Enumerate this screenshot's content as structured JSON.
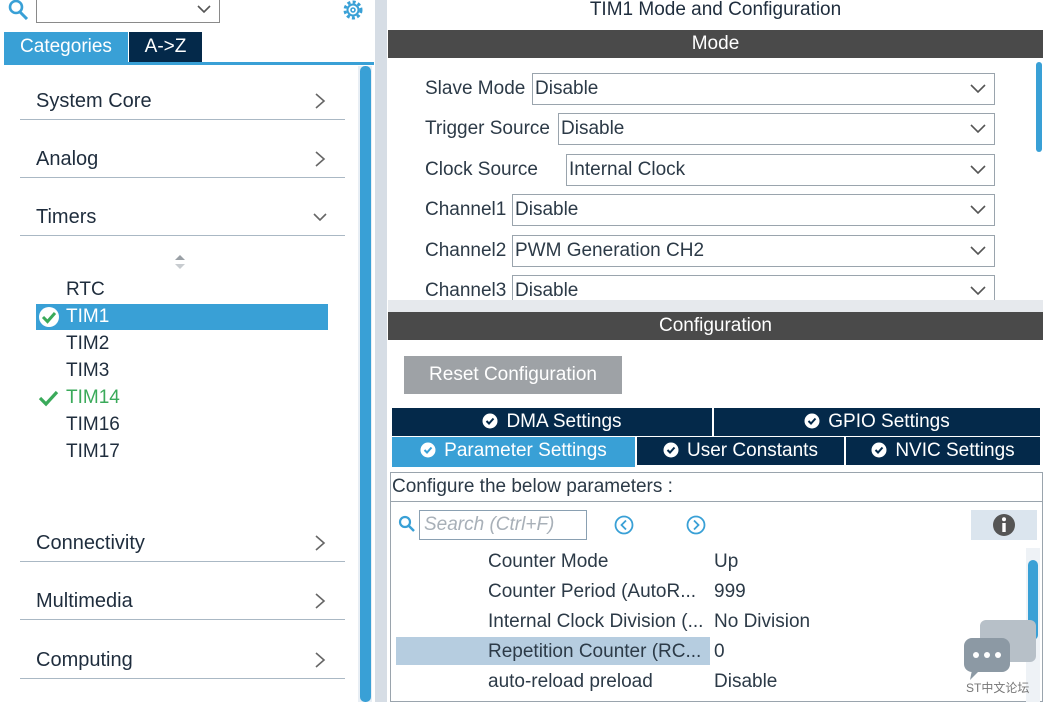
{
  "left_panel": {
    "search_value": "",
    "tabs": {
      "categories": "Categories",
      "az": "A->Z"
    },
    "categories": [
      {
        "label": "System Core",
        "expanded": false
      },
      {
        "label": "Analog",
        "expanded": false
      },
      {
        "label": "Timers",
        "expanded": true
      },
      {
        "label": "Connectivity",
        "expanded": false
      },
      {
        "label": "Multimedia",
        "expanded": false
      },
      {
        "label": "Computing",
        "expanded": false
      }
    ],
    "timers": [
      {
        "label": "RTC",
        "state": "none"
      },
      {
        "label": "TIM1",
        "state": "selected"
      },
      {
        "label": "TIM2",
        "state": "none"
      },
      {
        "label": "TIM3",
        "state": "none"
      },
      {
        "label": "TIM14",
        "state": "configured"
      },
      {
        "label": "TIM16",
        "state": "none"
      },
      {
        "label": "TIM17",
        "state": "none"
      }
    ]
  },
  "right_panel": {
    "title": "TIM1 Mode and Configuration",
    "mode_bar": "Mode",
    "mode_rows": [
      {
        "label": "Slave Mode",
        "value": "Disable"
      },
      {
        "label": "Trigger Source",
        "value": "Disable"
      },
      {
        "label": "Clock Source",
        "value": "Internal Clock"
      },
      {
        "label": "Channel1",
        "value": "Disable"
      },
      {
        "label": "Channel2",
        "value": "PWM Generation CH2"
      },
      {
        "label": "Channel3",
        "value": "Disable"
      }
    ],
    "config_bar": "Configuration",
    "reset_button": "Reset Configuration",
    "tabs": {
      "dma": "DMA Settings",
      "gpio": "GPIO Settings",
      "parameter": "Parameter Settings",
      "user": "User Constants",
      "nvic": "NVIC Settings"
    },
    "hint": "Configure the below parameters :",
    "search_placeholder": "Search (Ctrl+F)",
    "params": [
      {
        "name": "Counter Mode",
        "value": "Up",
        "highlighted": false
      },
      {
        "name": "Counter Period (AutoR...",
        "value": "999",
        "highlighted": false
      },
      {
        "name": "Internal Clock Division (...",
        "value": "No Division",
        "highlighted": false
      },
      {
        "name": "Repetition Counter (RC...",
        "value": "0",
        "highlighted": true
      },
      {
        "name": "auto-reload preload",
        "value": "Disable",
        "highlighted": false
      }
    ]
  },
  "watermark": "ST中文论坛",
  "colors": {
    "accent": "#39a0d6",
    "dark_tab": "#04294a",
    "bar": "#4a4a4a",
    "check_green": "#3aaa5a"
  }
}
